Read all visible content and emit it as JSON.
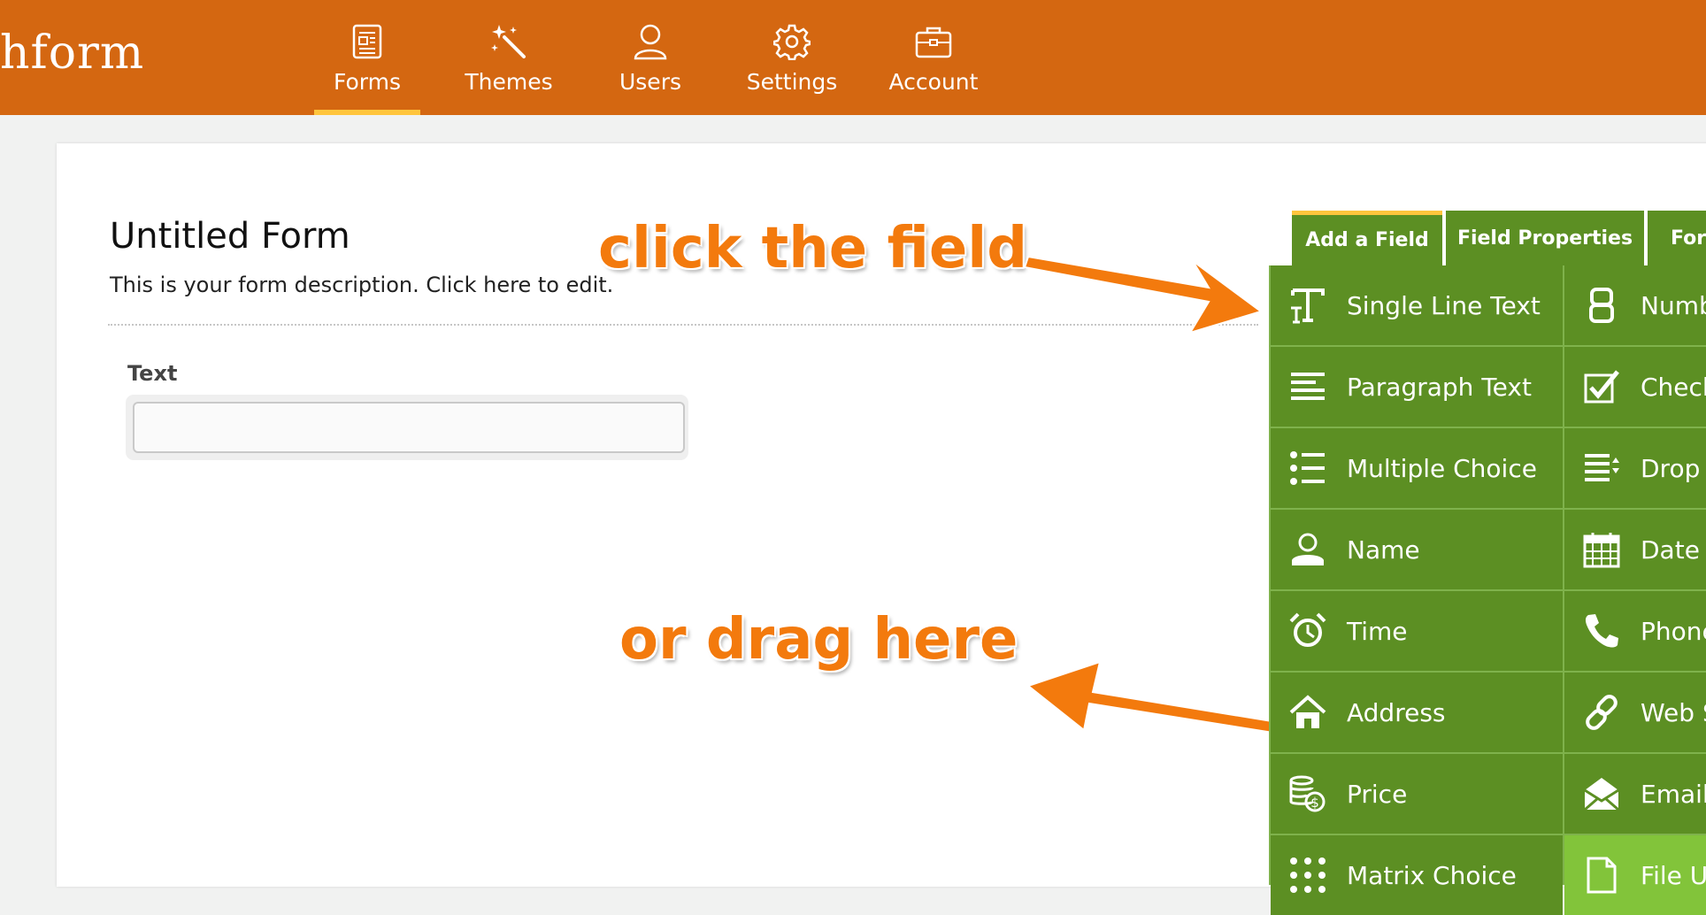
{
  "app": {
    "logo_text": "hform",
    "brand_color": "#d46711",
    "accent_color": "#ffc53d",
    "panel_green": "#5c8f23"
  },
  "nav": {
    "items": [
      {
        "label": "Forms",
        "icon": "forms-icon",
        "active": true
      },
      {
        "label": "Themes",
        "icon": "magic-wand-icon",
        "active": false
      },
      {
        "label": "Users",
        "icon": "user-icon",
        "active": false
      },
      {
        "label": "Settings",
        "icon": "gear-icon",
        "active": false
      },
      {
        "label": "Account",
        "icon": "briefcase-icon",
        "active": false
      }
    ]
  },
  "form": {
    "title": "Untitled Form",
    "description": "This is your form description. Click here to edit.",
    "fields": [
      {
        "label": "Text",
        "value": ""
      }
    ]
  },
  "annotations": {
    "click": "click the field",
    "drag": "or drag here"
  },
  "sidebar": {
    "tabs": [
      {
        "label": "Add a Field"
      },
      {
        "label": "Field Properties"
      },
      {
        "label": "For"
      }
    ],
    "left": [
      {
        "label": "Single Line Text",
        "icon": "text-t-icon"
      },
      {
        "label": "Paragraph Text",
        "icon": "paragraph-icon"
      },
      {
        "label": "Multiple Choice",
        "icon": "list-bullets-icon"
      },
      {
        "label": "Name",
        "icon": "person-icon"
      },
      {
        "label": "Time",
        "icon": "alarm-clock-icon"
      },
      {
        "label": "Address",
        "icon": "home-icon"
      },
      {
        "label": "Price",
        "icon": "coins-icon"
      },
      {
        "label": "Matrix Choice",
        "icon": "dot-grid-icon"
      }
    ],
    "right": [
      {
        "label": "Numb",
        "icon": "digit-eight-icon"
      },
      {
        "label": "Check",
        "icon": "checkbox-icon"
      },
      {
        "label": "Drop D",
        "icon": "dropdown-list-icon"
      },
      {
        "label": "Date",
        "icon": "calendar-icon"
      },
      {
        "label": "Phone",
        "icon": "phone-icon"
      },
      {
        "label": "Web S",
        "icon": "link-icon"
      },
      {
        "label": "Email",
        "icon": "envelope-icon"
      },
      {
        "label": "File U",
        "icon": "file-icon"
      }
    ]
  }
}
